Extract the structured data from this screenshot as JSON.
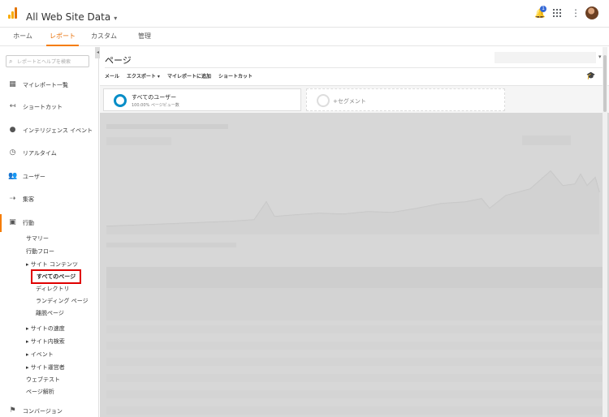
{
  "header": {
    "account_line": "",
    "title": "All Web Site Data",
    "notification_count": "1",
    "icons": [
      "analytics-logo",
      "bell-icon",
      "apps-grid-icon",
      "more-vert-icon",
      "avatar"
    ]
  },
  "tabs": [
    {
      "label": "ホーム",
      "active": false
    },
    {
      "label": "レポート",
      "active": true
    },
    {
      "label": "カスタム",
      "active": false
    },
    {
      "label": "管理",
      "active": false
    }
  ],
  "sidebar": {
    "search_placeholder": "レポートとヘルプを検索",
    "nav": [
      {
        "label": "マイレポート一覧",
        "icon": "grid-icon"
      },
      {
        "label": "ショートカット",
        "icon": "shortcut-arrow-icon"
      },
      {
        "label": "インテリジェンス イベント",
        "icon": "bulb-icon"
      },
      {
        "label": "リアルタイム",
        "icon": "clock-icon"
      },
      {
        "label": "ユーザー",
        "icon": "people-icon"
      },
      {
        "label": "集客",
        "icon": "acquisition-icon"
      },
      {
        "label": "行動",
        "icon": "behavior-icon",
        "active": true
      },
      {
        "label": "コンバージョン",
        "icon": "flag-icon"
      }
    ],
    "behavior_sub": {
      "summary": "サマリー",
      "flow": "行動フロー",
      "site_content": "サイト コンテンツ",
      "all_pages": "すべてのページ",
      "directory": "ディレクトリ",
      "landing": "ランディング ページ",
      "exit": "離脱ページ",
      "site_speed": "サイトの速度",
      "site_search": "サイト内検索",
      "events": "イベント",
      "publisher": "サイト運営者",
      "experiments": "ウェブテスト",
      "page_analytics": "ページ解析"
    }
  },
  "main": {
    "title": "ページ",
    "date_range": "",
    "toolbar": [
      "メール",
      "エクスポート ▾",
      "マイレポートに追加",
      "ショートカット"
    ],
    "segments": {
      "all_users": "すべてのユーザー",
      "all_users_sub": "100.00% ページビュー数",
      "add_segment": "+セグメント"
    }
  },
  "colors": {
    "accent": "#f57c00",
    "segment_ring": "#058dc7",
    "highlight_box": "#e00000"
  }
}
